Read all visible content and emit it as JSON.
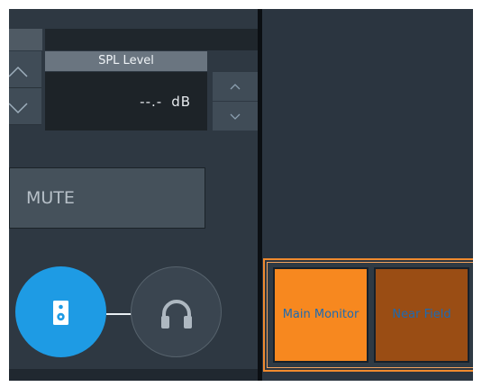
{
  "spl": {
    "title": "SPL Level",
    "value": "--.-",
    "unit": "dB"
  },
  "mute_label": "MUTE",
  "outputs": {
    "speaker_icon": "speaker-icon",
    "headphone_icon": "headphone-icon"
  },
  "monitors": {
    "main_label": "Main Monitor",
    "near_label": "Near Field"
  },
  "colors": {
    "accent_blue": "#1e9be4",
    "orange_active": "#f7881f",
    "orange_dark": "#9a4d14",
    "highlight_border": "#f08a2e"
  }
}
